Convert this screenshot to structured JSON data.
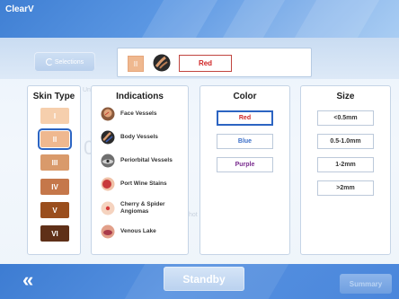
{
  "app": {
    "title": "ClearV"
  },
  "toolbar": {
    "selections_label": "Selections"
  },
  "summary": {
    "skin": "II",
    "indication_icon": "body-vessels-icon",
    "color": "Red"
  },
  "skin_type": {
    "title": "Skin Type",
    "items": [
      {
        "label": "I",
        "color": "#f6cfad",
        "selected": false
      },
      {
        "label": "II",
        "color": "#efb88f",
        "selected": true
      },
      {
        "label": "III",
        "color": "#d99a6b",
        "selected": false
      },
      {
        "label": "IV",
        "color": "#c5774a",
        "selected": false
      },
      {
        "label": "V",
        "color": "#9a4e1d",
        "selected": false
      },
      {
        "label": "VI",
        "color": "#5f3018",
        "selected": false
      }
    ]
  },
  "indications": {
    "title": "Indications",
    "items": [
      {
        "label": "Face Vessels",
        "icon": "face-vessels-icon"
      },
      {
        "label": "Body Vessels",
        "icon": "body-vessels-icon"
      },
      {
        "label": "Periorbital Vessels",
        "icon": "periorbital-vessels-icon"
      },
      {
        "label": "Port Wine Stains",
        "icon": "port-wine-stains-icon"
      },
      {
        "label": "Cherry & Spider Angiomas",
        "icon": "angiomas-icon"
      },
      {
        "label": "Venous Lake",
        "icon": "venous-lake-icon"
      }
    ]
  },
  "color": {
    "title": "Color",
    "options": [
      {
        "label": "Red",
        "text_color": "#d02525",
        "selected": true
      },
      {
        "label": "Blue",
        "text_color": "#3b6fc9",
        "selected": false
      },
      {
        "label": "Purple",
        "text_color": "#7a2d8f",
        "selected": false
      }
    ]
  },
  "size": {
    "title": "Size",
    "options": [
      {
        "label": "<0.5mm"
      },
      {
        "label": "0.5-1.0mm"
      },
      {
        "label": "1-2mm"
      },
      {
        "label": ">2mm"
      }
    ]
  },
  "bottom": {
    "back": "«",
    "standby": "Standby",
    "summary": "Summary"
  },
  "ghost": {
    "small_left": "Un",
    "big_left": "0",
    "mid": "hot"
  }
}
